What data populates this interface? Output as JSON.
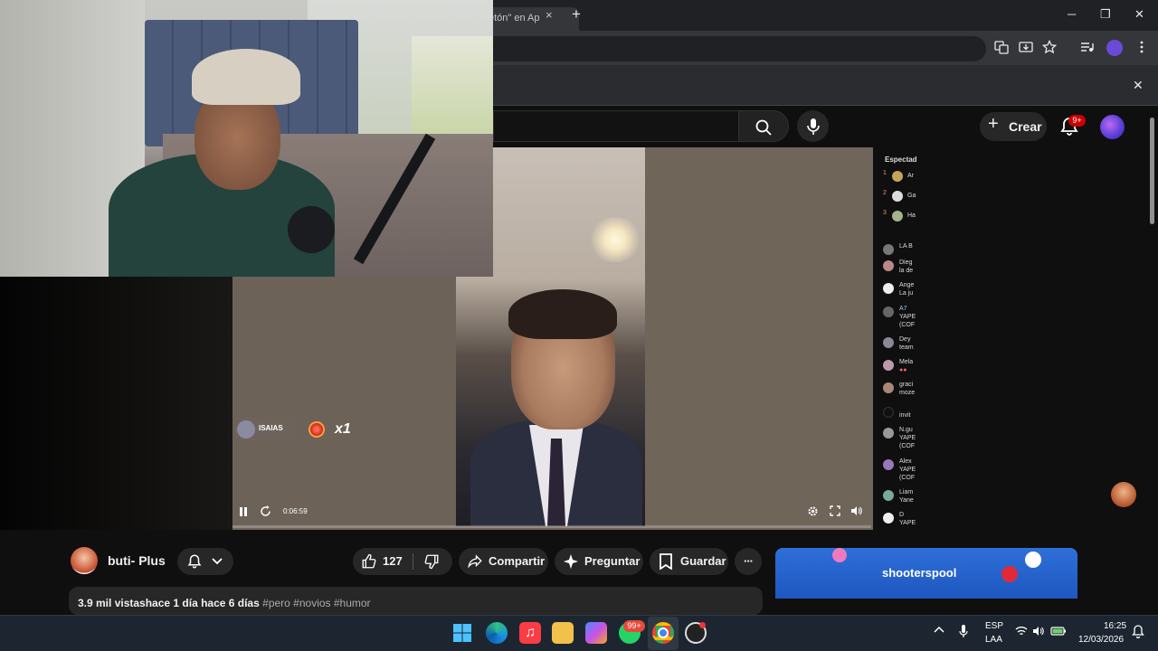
{
  "browser": {
    "tab_fragment": "etón\" en Ap",
    "tab_close": "×",
    "new_tab": "+",
    "win_min": "─",
    "win_max": "❐",
    "win_close": "✕",
    "infobar_close": "✕"
  },
  "youtube": {
    "create_label": "Crear",
    "notif_count": "9+"
  },
  "player": {
    "gift_user": "ISAIAS",
    "gift_count": "x1",
    "time": "0:06:59"
  },
  "chat": {
    "header": "Espectad",
    "top_rows": [
      {
        "rank": "1",
        "name": "Ar"
      },
      {
        "rank": "2",
        "name": "Ga"
      },
      {
        "rank": "3",
        "name": "Ha"
      }
    ],
    "messages": [
      {
        "name": "LA B",
        "text": ""
      },
      {
        "name": "Dieg",
        "text": "la de"
      },
      {
        "name": "Ange",
        "text": "La ju"
      },
      {
        "name": "A7",
        "text": "YAPE (COF"
      },
      {
        "name": "Dey",
        "text": "team"
      },
      {
        "name": "Mela",
        "text": ""
      },
      {
        "name": "graci",
        "text": "moze"
      },
      {
        "name": "invit",
        "text": ""
      },
      {
        "name": "N.gu",
        "text": "YAPE (COF"
      },
      {
        "name": "Alex",
        "text": "YAPE (COF"
      },
      {
        "name": "Liam",
        "text": "Yane"
      },
      {
        "name": "D",
        "text": "YAPE"
      }
    ]
  },
  "video_info": {
    "channel_name": "buti- Plus",
    "like_count": "127",
    "share_label": "Compartir",
    "ask_label": "Preguntar",
    "save_label": "Guardar",
    "more_label": "···",
    "description_stats": "3.9 mil vistashace 1 día  hace 6 días",
    "description_tags": "#pero #novios #humor"
  },
  "ad": {
    "brand": "shooterspool"
  },
  "taskbar": {
    "whatsapp_badge": "99+",
    "lang_line1": "ESP",
    "lang_line2": "LAA",
    "time": "16:25",
    "date": "12/03/2026"
  }
}
